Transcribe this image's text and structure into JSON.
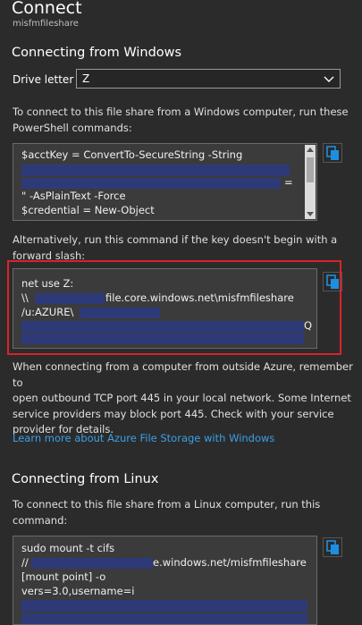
{
  "header": {
    "title": "Connect",
    "subtitle": "misfmfileshare"
  },
  "windows": {
    "heading": "Connecting from Windows",
    "drive_label": "Drive letter",
    "drive_value": "Z",
    "intro_line1": "To connect to this file share from a Windows computer, run these",
    "intro_line2": "PowerShell commands:",
    "ps_lines": [
      "$acctKey = ConvertTo-SecureString -String",
      "=",
      "\" -AsPlainText -Force",
      "$credential = New-Object"
    ],
    "alt_line1": "Alternatively, run this command if the key doesn't begin with a",
    "alt_line2": "forward slash:",
    "net_lines": [
      "net use Z:",
      "\\\\",
      "file.core.windows.net\\misfmfileshare",
      "/u:AZURE\\",
      "Q"
    ],
    "outside_lines": [
      "When connecting from a computer from outside Azure, remember to",
      "open outbound TCP port 445 in your local network. Some Internet",
      "service providers may block port 445. Check with your service",
      "provider for details."
    ],
    "learn_more": "Learn more about Azure File Storage with Windows"
  },
  "linux": {
    "heading": "Connecting from Linux",
    "intro_line1": "To connect to this file share from a Linux computer, run this",
    "intro_line2": "command:",
    "cmd_lines": [
      "sudo mount -t cifs",
      "//",
      "e.windows.net/misfmfileshare",
      "[mount point] -o",
      "vers=3.0,username=i"
    ]
  },
  "icons": {
    "copy": "copy-icon",
    "dropdown": "chevron-down-icon"
  },
  "colors": {
    "background": "#2b2b2b",
    "link": "#3aa0e6",
    "highlight": "#d9232a",
    "redaction": "#2e3a78",
    "copy_icon": "#1e8fe0"
  }
}
